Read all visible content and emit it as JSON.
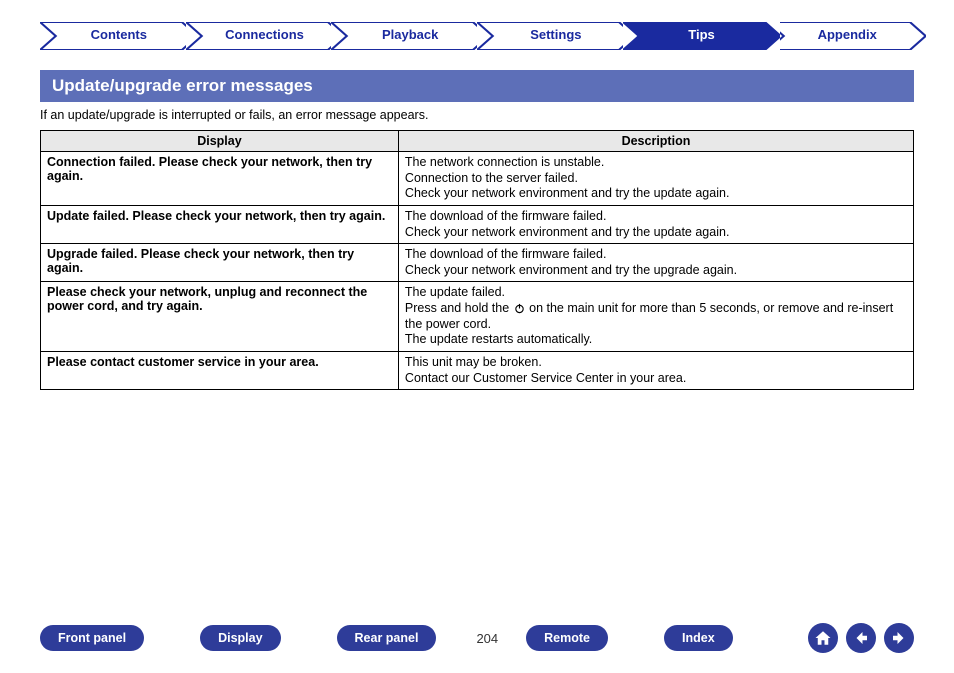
{
  "tabs": [
    {
      "label": "Contents",
      "active": false
    },
    {
      "label": "Connections",
      "active": false
    },
    {
      "label": "Playback",
      "active": false
    },
    {
      "label": "Settings",
      "active": false
    },
    {
      "label": "Tips",
      "active": true
    },
    {
      "label": "Appendix",
      "active": false
    }
  ],
  "section": {
    "title": "Update/upgrade error messages",
    "intro": "If an update/upgrade is interrupted or fails, an error message appears."
  },
  "table": {
    "headers": [
      "Display",
      "Description"
    ],
    "rows": [
      {
        "display": "Connection failed. Please check your network, then try again.",
        "description": [
          "The network connection is unstable.",
          "Connection to the server failed.",
          "Check your network environment and try the update again."
        ]
      },
      {
        "display": "Update failed. Please check your network, then try again.",
        "description": [
          "The download of the firmware failed.",
          "Check your network environment and try the update again."
        ]
      },
      {
        "display": "Upgrade failed. Please check your network, then try again.",
        "description": [
          "The download of the firmware failed.",
          "Check your network environment and try the upgrade again."
        ]
      },
      {
        "display": "Please check your network, unplug and reconnect the power cord, and try again.",
        "description": [
          "The update failed.",
          "Press and hold the {POWER} on the main unit for more than 5 seconds, or remove and re-insert the power cord.",
          "The update restarts automatically."
        ]
      },
      {
        "display": "Please contact customer service in your area.",
        "description": [
          "This unit may be broken.",
          "Contact our Customer Service Center in your area."
        ]
      }
    ]
  },
  "footer": {
    "buttons": [
      "Front panel",
      "Display",
      "Rear panel",
      "Remote",
      "Index"
    ],
    "page": "204"
  }
}
